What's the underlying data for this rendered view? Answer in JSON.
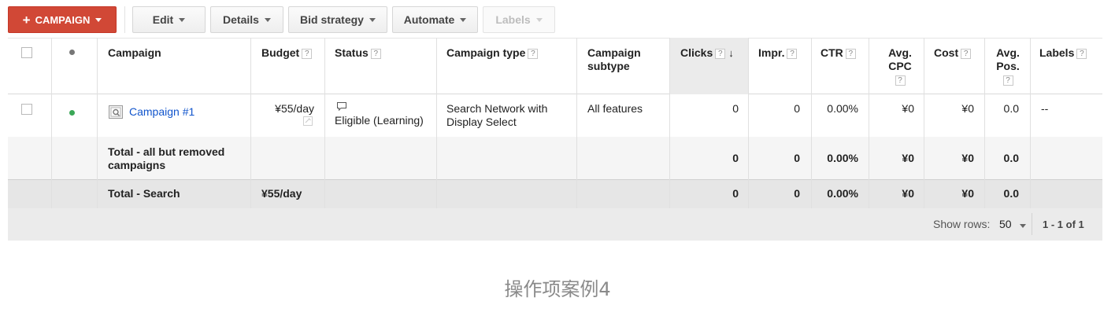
{
  "toolbar": {
    "campaign_button": "CAMPAIGN",
    "edit": "Edit",
    "details": "Details",
    "bid_strategy": "Bid strategy",
    "automate": "Automate",
    "labels": "Labels"
  },
  "table": {
    "headers": {
      "campaign": "Campaign",
      "budget": "Budget",
      "status": "Status",
      "campaign_type": "Campaign type",
      "campaign_subtype_1": "Campaign",
      "campaign_subtype_2": "subtype",
      "clicks": "Clicks",
      "impr": "Impr.",
      "ctr": "CTR",
      "avg_cpc_1": "Avg.",
      "avg_cpc_2": "CPC",
      "cost": "Cost",
      "avg_pos_1": "Avg.",
      "avg_pos_2": "Pos.",
      "labels": "Labels",
      "help": "?",
      "sort_arrow": "↓"
    },
    "row": {
      "campaign": "Campaign #1",
      "budget": "¥55/day",
      "status": "Eligible (Learning)",
      "type_1": "Search Network with",
      "type_2": "Display Select",
      "subtype": "All features",
      "clicks": "0",
      "impr": "0",
      "ctr": "0.00%",
      "avg_cpc": "¥0",
      "cost": "¥0",
      "avg_pos": "0.0",
      "labels": "--",
      "status_color": "#3aa757"
    },
    "total_all": {
      "label_1": "Total - all but removed",
      "label_2": "campaigns",
      "clicks": "0",
      "impr": "0",
      "ctr": "0.00%",
      "avg_cpc": "¥0",
      "cost": "¥0",
      "avg_pos": "0.0"
    },
    "total_search": {
      "label": "Total - Search",
      "budget": "¥55/day",
      "clicks": "0",
      "impr": "0",
      "ctr": "0.00%",
      "avg_cpc": "¥0",
      "cost": "¥0",
      "avg_pos": "0.0"
    },
    "footer": {
      "show_rows_label": "Show rows:",
      "show_rows_value": "50",
      "range": "1 - 1 of 1"
    }
  },
  "caption": "操作项案例4",
  "colors": {
    "accent": "#d14836",
    "link": "#1155cc",
    "header_dot": "#777777"
  }
}
